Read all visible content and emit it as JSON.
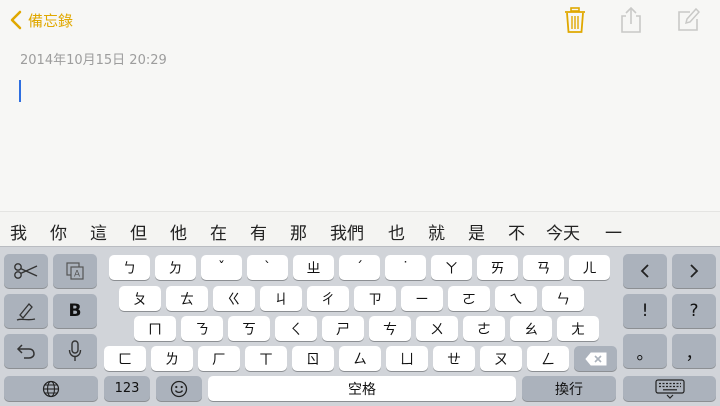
{
  "toolbar": {
    "back_label": "備忘錄",
    "accent": "#e0a800",
    "icons": [
      "chevron-left-icon",
      "trash-icon",
      "share-icon",
      "compose-icon"
    ]
  },
  "note": {
    "date": "2014年10月15日 20:29"
  },
  "candidates": [
    "我",
    "你",
    "這",
    "但",
    "他",
    "在",
    "有",
    "那",
    "我們",
    "也",
    "就",
    "是",
    "不",
    "今天",
    "一"
  ],
  "keyboard": {
    "row1": [
      "ㄅ",
      "ㄉ",
      "ˇ",
      "ˋ",
      "ㄓ",
      "ˊ",
      "˙",
      "ㄚ",
      "ㄞ",
      "ㄢ",
      "ㄦ"
    ],
    "row2": [
      "ㄆ",
      "ㄊ",
      "ㄍ",
      "ㄐ",
      "ㄔ",
      "ㄗ",
      "ㄧ",
      "ㄛ",
      "ㄟ",
      "ㄣ"
    ],
    "row3": [
      "ㄇ",
      "ㄋ",
      "ㄎ",
      "ㄑ",
      "ㄕ",
      "ㄘ",
      "ㄨ",
      "ㄜ",
      "ㄠ",
      "ㄤ"
    ],
    "row4": [
      "ㄈ",
      "ㄌ",
      "ㄏ",
      "ㄒ",
      "ㄖ",
      "ㄙ",
      "ㄩ",
      "ㄝ",
      "ㄡ",
      "ㄥ"
    ],
    "bold_label": "B",
    "exclaim_label": "!",
    "question_label": "?",
    "dot_label": "。",
    "comma_label": "，",
    "num_label": "123",
    "space_label": "空格",
    "return_label": "換行"
  }
}
